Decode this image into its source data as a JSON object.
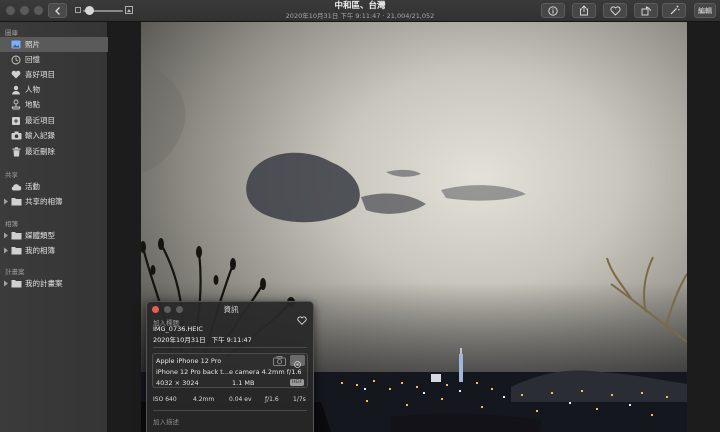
{
  "window": {
    "title": "中和區、台灣",
    "subtitle": "2020年10月31日 下午 9:11:47 · 21,004/21,052"
  },
  "toolbar": {
    "edit_label": "編輯",
    "zoom_level": 0.1
  },
  "sidebar": {
    "sections": [
      {
        "heading": "圖庫",
        "items": [
          {
            "label": "照片",
            "icon": "photos-icon",
            "active": true
          },
          {
            "label": "回憶",
            "icon": "memories-icon"
          },
          {
            "label": "喜好項目",
            "icon": "heart-icon"
          },
          {
            "label": "人物",
            "icon": "person-icon"
          },
          {
            "label": "地點",
            "icon": "pin-icon"
          },
          {
            "label": "最近項目",
            "icon": "recent-icon"
          },
          {
            "label": "輸入記錄",
            "icon": "camera-icon"
          },
          {
            "label": "最近刪除",
            "icon": "trash-icon"
          }
        ]
      },
      {
        "heading": "共享",
        "items": [
          {
            "label": "活動",
            "icon": "cloud-icon"
          },
          {
            "label": "共享的相簿",
            "icon": "shared-album-icon",
            "collapsible": true
          }
        ]
      },
      {
        "heading": "相簿",
        "items": [
          {
            "label": "媒體類型",
            "icon": "folder-icon",
            "collapsible": true
          },
          {
            "label": "我的相簿",
            "icon": "folder-icon",
            "collapsible": true
          }
        ]
      },
      {
        "heading": "計畫案",
        "items": [
          {
            "label": "我的計畫案",
            "icon": "folder-icon",
            "collapsible": true
          }
        ]
      }
    ]
  },
  "info_panel": {
    "title": "資訊",
    "add_title_placeholder": "加入標題",
    "filename": "IMG_0736.HEIC",
    "date": "2020年10月31日",
    "time": "下午 9:11:47",
    "camera_make": "Apple iPhone 12 Pro",
    "lens": "iPhone 12 Pro back t...e camera 4.2mm f/1.6",
    "resolution": "4032 × 3024",
    "file_size": "1.1 MB",
    "format_badge": "HEIF",
    "exif": {
      "iso": "ISO 640",
      "focal_length": "4.2mm",
      "exposure_bias": "0.04 ev",
      "aperture": "ƒ/1.6",
      "shutter": "1/7s"
    },
    "add_description_placeholder": "加入描述"
  }
}
